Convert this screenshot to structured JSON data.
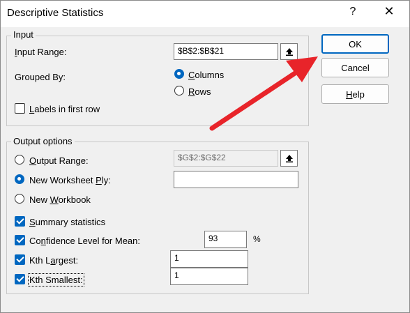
{
  "window": {
    "title": "Descriptive Statistics",
    "help_glyph": "?",
    "close_glyph": "✕"
  },
  "input": {
    "legend": "Input",
    "input_range_label_pre": "",
    "input_range_label_u": "I",
    "input_range_label_post": "nput Range:",
    "input_range_value": "$B$2:$B$21",
    "grouped_by_label": "Grouped By:",
    "columns_pre": "",
    "columns_u": "C",
    "columns_post": "olumns",
    "rows_pre": "",
    "rows_u": "R",
    "rows_post": "ows",
    "labels_pre": "",
    "labels_u": "L",
    "labels_post": "abels in first row"
  },
  "output": {
    "legend": "Output options",
    "output_range_pre": "",
    "output_range_u": "O",
    "output_range_post": "utput Range:",
    "output_range_value": "$G$2:$G$22",
    "new_ws_pre": "New Worksheet ",
    "new_ws_u": "P",
    "new_ws_post": "ly:",
    "new_ws_value": "",
    "new_wb_pre": "New ",
    "new_wb_u": "W",
    "new_wb_post": "orkbook",
    "summary_pre": "",
    "summary_u": "S",
    "summary_post": "ummary statistics",
    "conf_pre": "Co",
    "conf_u": "n",
    "conf_post": "fidence Level for Mean:",
    "conf_value": "93",
    "conf_unit": "%",
    "kth_largest_pre": "Kth L",
    "kth_largest_u": "a",
    "kth_largest_post": "rgest:",
    "kth_largest_value": "1",
    "kth_smallest_pre": "Kth Smallest:",
    "kth_smallest_value": "1"
  },
  "buttons": {
    "ok": "OK",
    "cancel": "Cancel",
    "help_pre": "",
    "help_u": "H",
    "help_post": "elp"
  },
  "colors": {
    "accent": "#0067c0",
    "annotation_arrow": "#e8242a"
  }
}
